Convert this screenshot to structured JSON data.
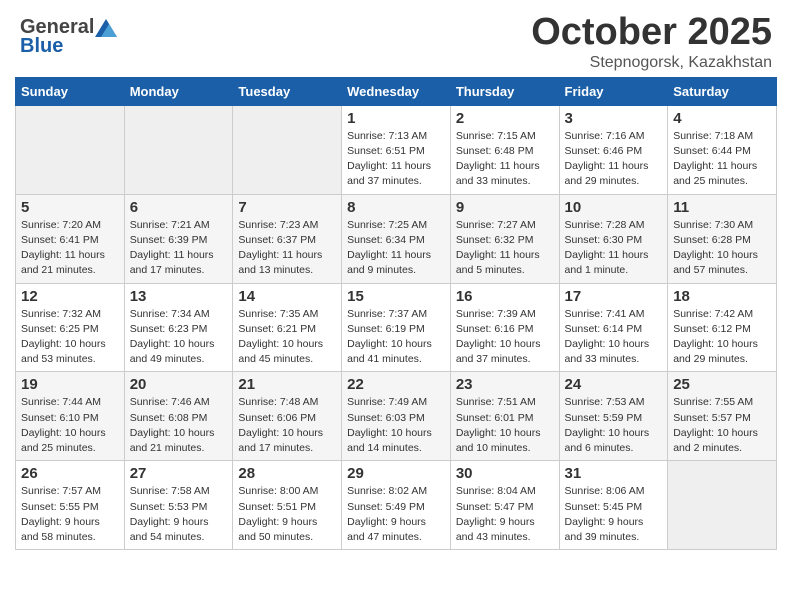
{
  "header": {
    "logo_general": "General",
    "logo_blue": "Blue",
    "month_title": "October 2025",
    "location": "Stepnogorsk, Kazakhstan"
  },
  "days_of_week": [
    "Sunday",
    "Monday",
    "Tuesday",
    "Wednesday",
    "Thursday",
    "Friday",
    "Saturday"
  ],
  "weeks": [
    [
      {
        "day": "",
        "info": ""
      },
      {
        "day": "",
        "info": ""
      },
      {
        "day": "",
        "info": ""
      },
      {
        "day": "1",
        "info": "Sunrise: 7:13 AM\nSunset: 6:51 PM\nDaylight: 11 hours\nand 37 minutes."
      },
      {
        "day": "2",
        "info": "Sunrise: 7:15 AM\nSunset: 6:48 PM\nDaylight: 11 hours\nand 33 minutes."
      },
      {
        "day": "3",
        "info": "Sunrise: 7:16 AM\nSunset: 6:46 PM\nDaylight: 11 hours\nand 29 minutes."
      },
      {
        "day": "4",
        "info": "Sunrise: 7:18 AM\nSunset: 6:44 PM\nDaylight: 11 hours\nand 25 minutes."
      }
    ],
    [
      {
        "day": "5",
        "info": "Sunrise: 7:20 AM\nSunset: 6:41 PM\nDaylight: 11 hours\nand 21 minutes."
      },
      {
        "day": "6",
        "info": "Sunrise: 7:21 AM\nSunset: 6:39 PM\nDaylight: 11 hours\nand 17 minutes."
      },
      {
        "day": "7",
        "info": "Sunrise: 7:23 AM\nSunset: 6:37 PM\nDaylight: 11 hours\nand 13 minutes."
      },
      {
        "day": "8",
        "info": "Sunrise: 7:25 AM\nSunset: 6:34 PM\nDaylight: 11 hours\nand 9 minutes."
      },
      {
        "day": "9",
        "info": "Sunrise: 7:27 AM\nSunset: 6:32 PM\nDaylight: 11 hours\nand 5 minutes."
      },
      {
        "day": "10",
        "info": "Sunrise: 7:28 AM\nSunset: 6:30 PM\nDaylight: 11 hours\nand 1 minute."
      },
      {
        "day": "11",
        "info": "Sunrise: 7:30 AM\nSunset: 6:28 PM\nDaylight: 10 hours\nand 57 minutes."
      }
    ],
    [
      {
        "day": "12",
        "info": "Sunrise: 7:32 AM\nSunset: 6:25 PM\nDaylight: 10 hours\nand 53 minutes."
      },
      {
        "day": "13",
        "info": "Sunrise: 7:34 AM\nSunset: 6:23 PM\nDaylight: 10 hours\nand 49 minutes."
      },
      {
        "day": "14",
        "info": "Sunrise: 7:35 AM\nSunset: 6:21 PM\nDaylight: 10 hours\nand 45 minutes."
      },
      {
        "day": "15",
        "info": "Sunrise: 7:37 AM\nSunset: 6:19 PM\nDaylight: 10 hours\nand 41 minutes."
      },
      {
        "day": "16",
        "info": "Sunrise: 7:39 AM\nSunset: 6:16 PM\nDaylight: 10 hours\nand 37 minutes."
      },
      {
        "day": "17",
        "info": "Sunrise: 7:41 AM\nSunset: 6:14 PM\nDaylight: 10 hours\nand 33 minutes."
      },
      {
        "day": "18",
        "info": "Sunrise: 7:42 AM\nSunset: 6:12 PM\nDaylight: 10 hours\nand 29 minutes."
      }
    ],
    [
      {
        "day": "19",
        "info": "Sunrise: 7:44 AM\nSunset: 6:10 PM\nDaylight: 10 hours\nand 25 minutes."
      },
      {
        "day": "20",
        "info": "Sunrise: 7:46 AM\nSunset: 6:08 PM\nDaylight: 10 hours\nand 21 minutes."
      },
      {
        "day": "21",
        "info": "Sunrise: 7:48 AM\nSunset: 6:06 PM\nDaylight: 10 hours\nand 17 minutes."
      },
      {
        "day": "22",
        "info": "Sunrise: 7:49 AM\nSunset: 6:03 PM\nDaylight: 10 hours\nand 14 minutes."
      },
      {
        "day": "23",
        "info": "Sunrise: 7:51 AM\nSunset: 6:01 PM\nDaylight: 10 hours\nand 10 minutes."
      },
      {
        "day": "24",
        "info": "Sunrise: 7:53 AM\nSunset: 5:59 PM\nDaylight: 10 hours\nand 6 minutes."
      },
      {
        "day": "25",
        "info": "Sunrise: 7:55 AM\nSunset: 5:57 PM\nDaylight: 10 hours\nand 2 minutes."
      }
    ],
    [
      {
        "day": "26",
        "info": "Sunrise: 7:57 AM\nSunset: 5:55 PM\nDaylight: 9 hours\nand 58 minutes."
      },
      {
        "day": "27",
        "info": "Sunrise: 7:58 AM\nSunset: 5:53 PM\nDaylight: 9 hours\nand 54 minutes."
      },
      {
        "day": "28",
        "info": "Sunrise: 8:00 AM\nSunset: 5:51 PM\nDaylight: 9 hours\nand 50 minutes."
      },
      {
        "day": "29",
        "info": "Sunrise: 8:02 AM\nSunset: 5:49 PM\nDaylight: 9 hours\nand 47 minutes."
      },
      {
        "day": "30",
        "info": "Sunrise: 8:04 AM\nSunset: 5:47 PM\nDaylight: 9 hours\nand 43 minutes."
      },
      {
        "day": "31",
        "info": "Sunrise: 8:06 AM\nSunset: 5:45 PM\nDaylight: 9 hours\nand 39 minutes."
      },
      {
        "day": "",
        "info": ""
      }
    ]
  ]
}
